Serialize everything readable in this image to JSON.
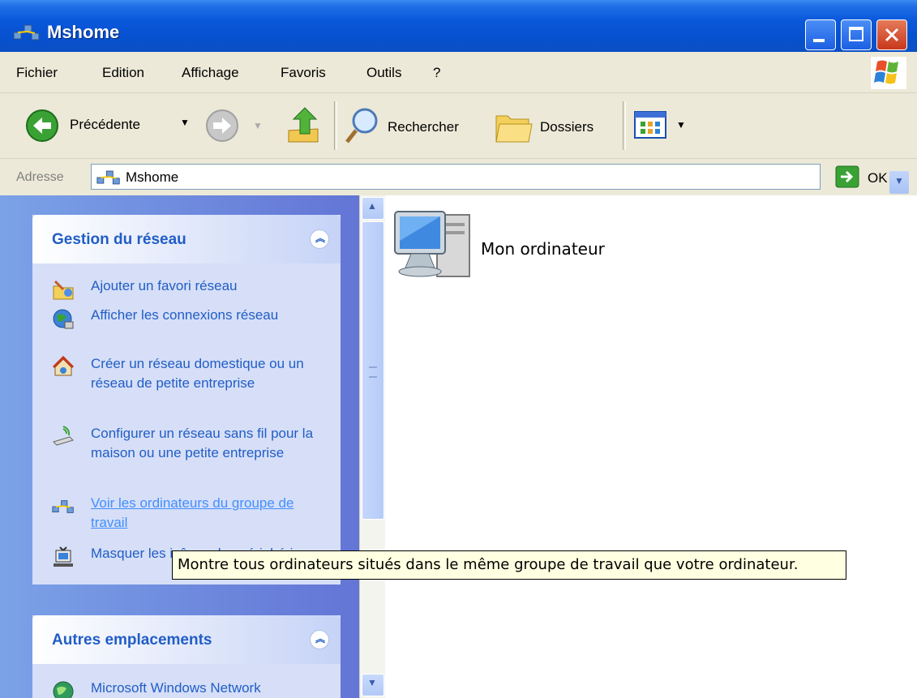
{
  "window": {
    "title": "Mshome"
  },
  "menu": {
    "items": [
      "Fichier",
      "Edition",
      "Affichage",
      "Favoris",
      "Outils",
      "?"
    ]
  },
  "toolbar": {
    "back_label": "Précédente",
    "search_label": "Rechercher",
    "folders_label": "Dossiers"
  },
  "address": {
    "label": "Adresse",
    "value": "Mshome",
    "go_label": "OK"
  },
  "taskpane": {
    "network_tasks": {
      "title": "Gestion du réseau",
      "items": [
        {
          "label": "Ajouter un favori réseau",
          "icon": "add-network-place-icon"
        },
        {
          "label": "Afficher les connexions réseau",
          "icon": "network-connections-icon"
        },
        {
          "label": "Créer un réseau domestique ou un réseau de petite entreprise",
          "icon": "home-network-icon"
        },
        {
          "label": "Configurer un réseau sans fil pour la maison ou une petite entreprise",
          "icon": "wireless-network-icon"
        },
        {
          "label": "Voir les ordinateurs du groupe de travail",
          "icon": "workgroup-icon"
        },
        {
          "label": "Masquer les icônes des périphériques",
          "icon": "upnp-device-icon"
        }
      ]
    },
    "other_places": {
      "title": "Autres emplacements",
      "items": [
        {
          "label": "Microsoft Windows Network",
          "icon": "windows-network-icon"
        }
      ]
    }
  },
  "content": {
    "items": [
      {
        "label": "Mon ordinateur",
        "icon": "my-computer-icon"
      }
    ]
  },
  "tooltip": {
    "text": "Montre tous ordinateurs situés dans le même groupe de travail que votre ordinateur."
  },
  "colors": {
    "title_bar": "#0a58db",
    "task_link": "#215dc6",
    "tooltip_bg": "#ffffe1"
  }
}
